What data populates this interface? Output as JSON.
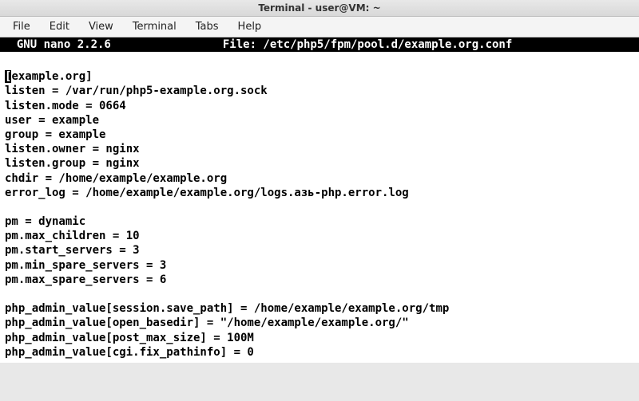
{
  "window": {
    "title": "Terminal - user@VM: ~"
  },
  "menubar": {
    "items": [
      "File",
      "Edit",
      "View",
      "Terminal",
      "Tabs",
      "Help"
    ]
  },
  "editor": {
    "header_left": "  GNU nano 2.2.6",
    "header_file": "File: /etc/php5/fpm/pool.d/example.org.conf",
    "cursor_char": "[",
    "first_line_rest": "example.org]",
    "body_rest": "listen = /var/run/php5-example.org.sock\nlisten.mode = 0664\nuser = example\ngroup = example\nlisten.owner = nginx\nlisten.group = nginx\nchdir = /home/example/example.org\nerror_log = /home/example/example.org/logs.азь-php.error.log\n\npm = dynamic\npm.max_children = 10\npm.start_servers = 3\npm.min_spare_servers = 3\npm.max_spare_servers = 6\n\nphp_admin_value[session.save_path] = /home/example/example.org/tmp\nphp_admin_value[open_basedir] = \"/home/example/example.org/\"\nphp_admin_value[post_max_size] = 100M\nphp_admin_value[cgi.fix_pathinfo] = 0"
  }
}
